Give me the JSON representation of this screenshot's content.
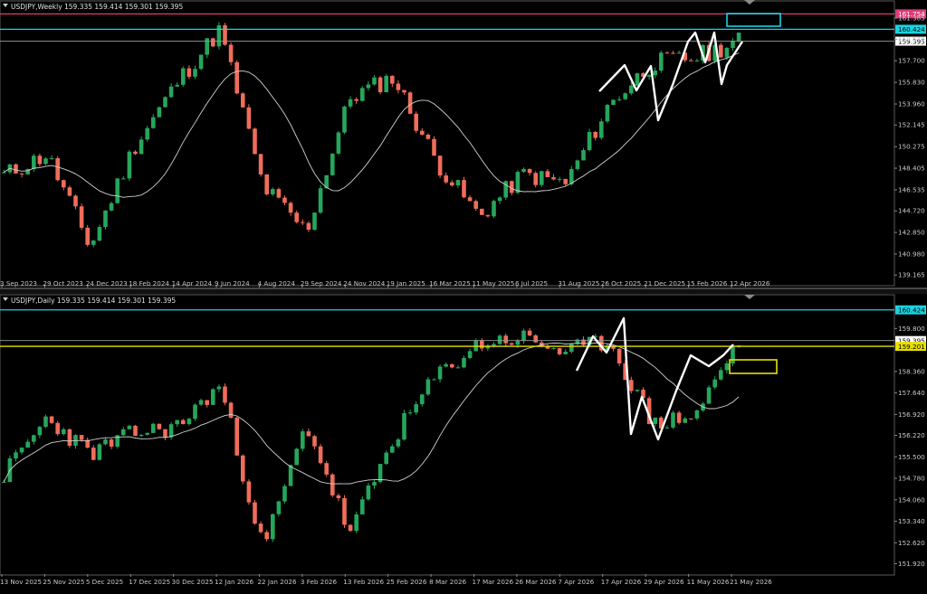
{
  "colors": {
    "background": "#000000",
    "bull": "#26a65b",
    "bear": "#ef6d5a",
    "ma": "#d0d0d0",
    "axis_text": "#c8c8c8",
    "panel_border": "#5a5a5a",
    "cyan": "#19d3e0",
    "magenta": "#e03a7a",
    "yellow": "#e8e000",
    "price_line": "#9a9a9a",
    "annotation": "#ffffff",
    "divider": "#7a7a7a"
  },
  "panels": [
    {
      "id": "weekly",
      "title": "USDJPY,Weekly  159.335 159.414 159.301 159.395",
      "y_ticks": [
        "161.385",
        "159.570",
        "157.700",
        "155.830",
        "153.960",
        "152.145",
        "150.275",
        "148.405",
        "146.535",
        "144.720",
        "142.850",
        "140.980",
        "139.165"
      ],
      "x_ticks": [
        "3 Sep 2023",
        "29 Oct 2023",
        "24 Dec 2023",
        "18 Feb 2024",
        "14 Apr 2024",
        "9 Jun 2024",
        "4 Aug 2024",
        "29 Sep 2024",
        "24 Nov 2024",
        "19 Jan 2025",
        "16 Mar 2025",
        "11 May 2025",
        "6 Jul 2025",
        "31 Aug 2025",
        "26 Oct 2025",
        "21 Dec 2025",
        "15 Feb 2026",
        "12 Apr 2026"
      ],
      "levels": [
        {
          "name": "magenta-level",
          "value": 161.754,
          "label": "161.754",
          "color": "magenta"
        },
        {
          "name": "cyan-level",
          "value": 160.424,
          "label": "160.424",
          "color": "cyan"
        },
        {
          "name": "current-price",
          "value": 159.395,
          "label": "159.395",
          "color": "price_line"
        }
      ]
    },
    {
      "id": "daily",
      "title": "USDJPY,Daily  159.335 159.414 159.301 159.395",
      "y_ticks": [
        "159.800",
        "158.360",
        "157.640",
        "156.920",
        "156.220",
        "155.500",
        "154.780",
        "154.060",
        "153.340",
        "152.620",
        "151.920"
      ],
      "x_ticks": [
        "13 Nov 2025",
        "25 Nov 2025",
        "5 Dec 2025",
        "17 Dec 2025",
        "30 Dec 2025",
        "12 Jan 2026",
        "22 Jan 2026",
        "3 Feb 2026",
        "13 Feb 2026",
        "25 Feb 2026",
        "8 Mar 2026",
        "17 Mar 2026",
        "26 Mar 2026",
        "7 Apr 2026",
        "17 Apr 2026",
        "29 Apr 2026",
        "11 May 2026",
        "21 May 2026"
      ],
      "levels": [
        {
          "name": "cyan-level",
          "value": 160.424,
          "label": "160.424",
          "color": "cyan"
        },
        {
          "name": "current-price",
          "value": 159.395,
          "label": "159.395",
          "color": "price_line"
        },
        {
          "name": "yellow-level",
          "value": 159.201,
          "label": "159.201",
          "color": "yellow"
        }
      ]
    }
  ],
  "chart_data": [
    {
      "type": "candlestick",
      "symbol": "USDJPY",
      "timeframe": "Weekly",
      "title": "USDJPY,Weekly  159.335 159.414 159.301 159.395",
      "ohlc_last": {
        "open": 159.335,
        "high": 159.414,
        "low": 159.301,
        "close": 159.395
      },
      "ylim": [
        138.4,
        162.8
      ],
      "x": [
        "3 Sep 2023",
        "29 Oct 2023",
        "24 Dec 2023",
        "18 Feb 2024",
        "14 Apr 2024",
        "9 Jun 2024",
        "4 Aug 2024",
        "29 Sep 2024",
        "24 Nov 2024",
        "19 Jan 2025",
        "16 Mar 2025",
        "11 May 2025",
        "6 Jul 2025",
        "31 Aug 2025",
        "26 Oct 2025",
        "21 Dec 2025",
        "15 Feb 2026",
        "12 Apr 2026"
      ],
      "close_path": [
        [
          "3 Sep 2023",
          147.8
        ],
        [
          "29 Oct 2023",
          149.6
        ],
        [
          "24 Dec 2023",
          141.6
        ],
        [
          "18 Feb 2024",
          150.2
        ],
        [
          "14 Apr 2024",
          155.8
        ],
        [
          "9 Jun 2024",
          160.4
        ],
        [
          "4 Aug 2024",
          146.8
        ],
        [
          "29 Sep 2024",
          142.9
        ],
        [
          "24 Nov 2024",
          154.5
        ],
        [
          "19 Jan 2025",
          156.3
        ],
        [
          "16 Mar 2025",
          149.0
        ],
        [
          "11 May 2025",
          144.2
        ],
        [
          "6 Jul 2025",
          147.9
        ],
        [
          "31 Aug 2025",
          147.1
        ],
        [
          "26 Oct 2025",
          153.9
        ],
        [
          "21 Dec 2025",
          157.5
        ],
        [
          "15 Feb 2026",
          158.0
        ],
        [
          "12 Apr 2026",
          159.4
        ]
      ],
      "moving_average": "simple",
      "series": [
        {
          "values": []
        }
      ]
    },
    {
      "type": "candlestick",
      "symbol": "USDJPY",
      "timeframe": "Daily",
      "title": "USDJPY,Daily  159.335 159.414 159.301 159.395",
      "ohlc_last": {
        "open": 159.335,
        "high": 159.414,
        "low": 159.301,
        "close": 159.395
      },
      "ylim": [
        151.6,
        160.9
      ],
      "x": [
        "13 Nov 2025",
        "25 Nov 2025",
        "5 Dec 2025",
        "17 Dec 2025",
        "30 Dec 2025",
        "12 Jan 2026",
        "22 Jan 2026",
        "3 Feb 2026",
        "13 Feb 2026",
        "25 Feb 2026",
        "8 Mar 2026",
        "17 Mar 2026",
        "26 Mar 2026",
        "7 Apr 2026",
        "17 Apr 2026",
        "29 Apr 2026",
        "11 May 2026",
        "21 May 2026"
      ],
      "close_path": [
        [
          "13 Nov 2025",
          154.9
        ],
        [
          "25 Nov 2025",
          156.8
        ],
        [
          "5 Dec 2025",
          155.6
        ],
        [
          "17 Dec 2025",
          156.3
        ],
        [
          "30 Dec 2025",
          156.5
        ],
        [
          "12 Jan 2026",
          157.9
        ],
        [
          "22 Jan 2026",
          152.4
        ],
        [
          "3 Feb 2026",
          156.6
        ],
        [
          "13 Feb 2026",
          152.9
        ],
        [
          "25 Feb 2026",
          156.1
        ],
        [
          "8 Mar 2026",
          158.2
        ],
        [
          "17 Mar 2026",
          159.3
        ],
        [
          "26 Mar 2026",
          159.5
        ],
        [
          "7 Apr 2026",
          159.0
        ],
        [
          "17 Apr 2026",
          159.4
        ],
        [
          "29 Apr 2026",
          156.6
        ],
        [
          "11 May 2026",
          156.9
        ],
        [
          "21 May 2026",
          159.4
        ]
      ]
    }
  ]
}
